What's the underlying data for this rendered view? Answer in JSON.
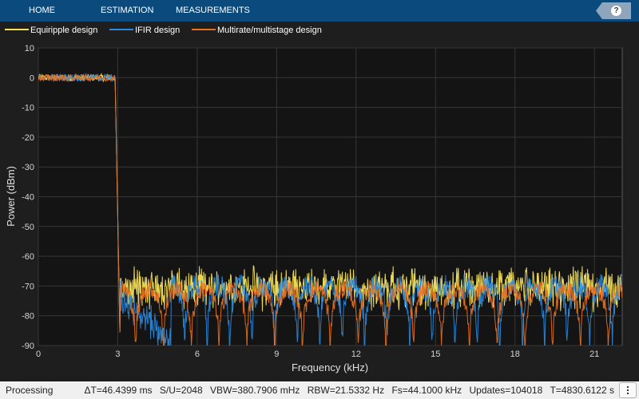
{
  "toolstrip": {
    "tabs": [
      "HOME",
      "ESTIMATION",
      "MEASUREMENTS"
    ],
    "help_label": "?",
    "help_icon": "help-icon"
  },
  "colors": {
    "toolstrip_bg": "#0b4a7d",
    "plot_bg": "#141414",
    "panel_bg": "#1e1e1e",
    "grid": "#3a3a3a",
    "axis_text": "#d4d4d4",
    "series": [
      "#f5e15a",
      "#2a8be0",
      "#ea7122"
    ]
  },
  "chart_data": {
    "type": "line",
    "title": "",
    "xlabel": "Frequency (kHz)",
    "ylabel": "Power (dBm)",
    "xlim": [
      0,
      22.05
    ],
    "ylim": [
      -90,
      10
    ],
    "xticks": [
      0,
      3,
      6,
      9,
      12,
      15,
      18,
      21
    ],
    "yticks": [
      10,
      0,
      -10,
      -20,
      -30,
      -40,
      -50,
      -60,
      -70,
      -80,
      -90
    ],
    "grid": true,
    "legend_position": "top",
    "series": [
      {
        "name": "Equiripple design",
        "color": "#f5e15a",
        "passband_level": 0,
        "passband_edge_khz": 2.9,
        "stopband_start_khz": 3.1,
        "stopband_floor": -70,
        "stopband_ripple_db": 4
      },
      {
        "name": "IFIR design",
        "color": "#2a8be0",
        "passband_level": 0,
        "passband_edge_khz": 2.9,
        "stopband_start_khz": 3.1,
        "stopband_floor": -70,
        "stopband_ripple_db": 4
      },
      {
        "name": "Multirate/multistage design",
        "color": "#ea7122",
        "passband_level": 0,
        "passband_edge_khz": 2.9,
        "stopband_start_khz": 3.1,
        "stopband_floor": -71,
        "stopband_ripple_db": 3
      }
    ]
  },
  "status": {
    "state": "Processing",
    "dt": "ΔT=46.4399 ms",
    "su": "S/U=2048",
    "vbw": "VBW=380.7906 mHz",
    "rbw": "RBW=21.5332 Hz",
    "fs": "Fs=44.1000 kHz",
    "updates": "Updates=104018",
    "t": "T=4830.6122 s"
  }
}
